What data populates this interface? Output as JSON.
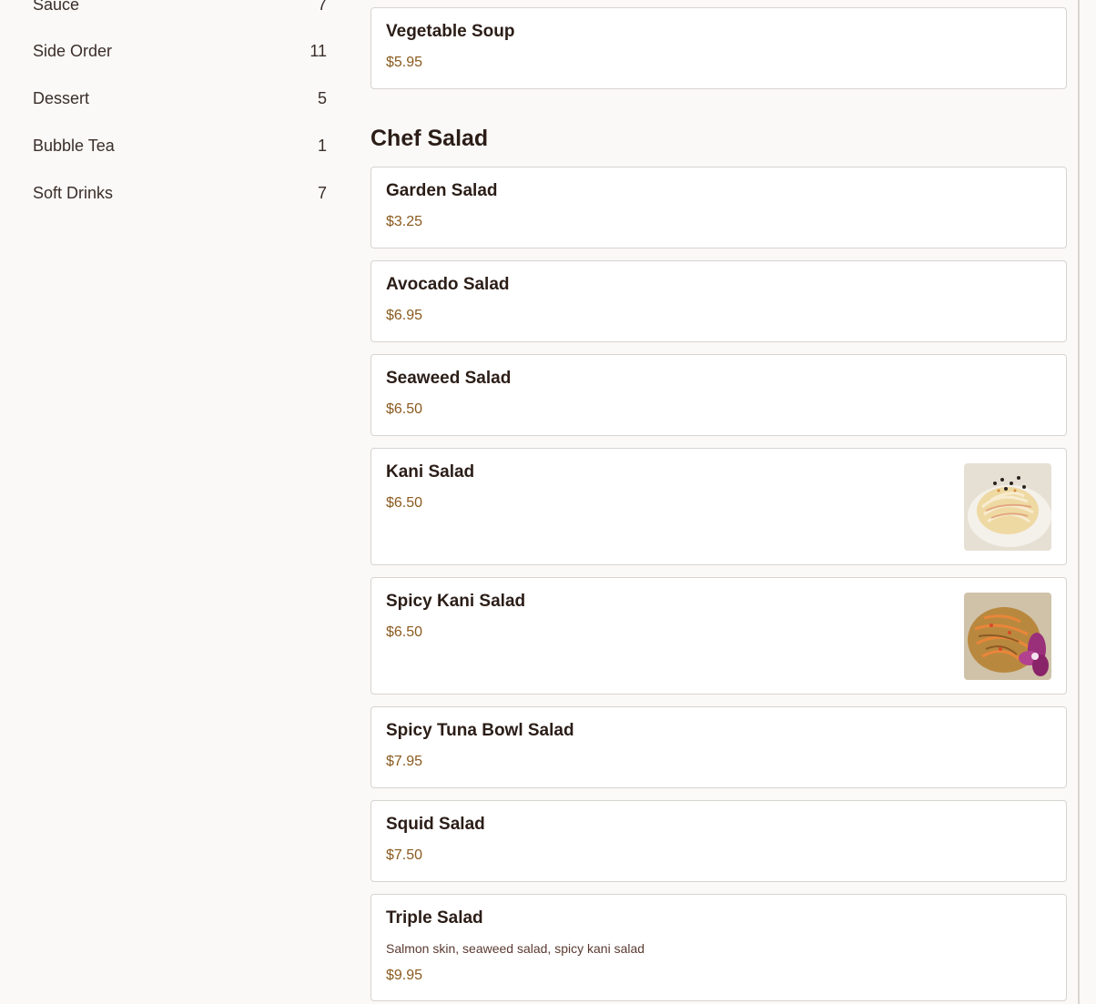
{
  "sidebar": {
    "categories": [
      {
        "label": "Sauce",
        "count": "7"
      },
      {
        "label": "Side Order",
        "count": "11"
      },
      {
        "label": "Dessert",
        "count": "5"
      },
      {
        "label": "Bubble Tea",
        "count": "1"
      },
      {
        "label": "Soft Drinks",
        "count": "7"
      }
    ]
  },
  "menu": {
    "prev_item": {
      "name": "Vegetable Soup",
      "price": "$5.95"
    },
    "section_title": "Chef Salad",
    "items": [
      {
        "name": "Garden Salad",
        "price": "$3.25"
      },
      {
        "name": "Avocado Salad",
        "price": "$6.95"
      },
      {
        "name": "Seaweed Salad",
        "price": "$6.50"
      },
      {
        "name": "Kani Salad",
        "price": "$6.50",
        "image": "kani-salad-photo"
      },
      {
        "name": "Spicy Kani Salad",
        "price": "$6.50",
        "image": "spicy-kani-salad-photo"
      },
      {
        "name": "Spicy Tuna Bowl Salad",
        "price": "$7.95"
      },
      {
        "name": "Squid Salad",
        "price": "$7.50"
      },
      {
        "name": "Triple Salad",
        "description": "Salmon skin, seaweed salad, spicy kani salad",
        "price": "$9.95"
      }
    ]
  },
  "colors": {
    "page_background": "#faf9f7",
    "card_border": "#d7d3d0",
    "title_text": "#2b1d17",
    "price_text": "#8a5a1e"
  }
}
